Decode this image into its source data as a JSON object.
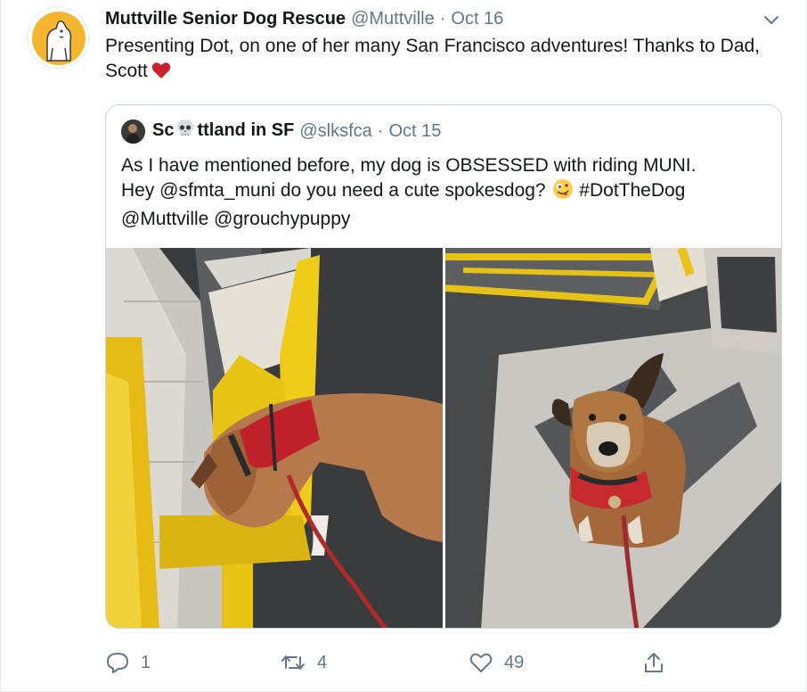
{
  "tweet": {
    "author_name": "Muttville Senior Dog Rescue",
    "handle": "@Muttville",
    "separator": "·",
    "date": "Oct 16",
    "text": "Presenting Dot, on one of her many San Francisco adventures! Thanks to Dad, Scott",
    "heart_emoji": "red-heart",
    "avatar_icon": "dog-logo-icon",
    "menu_icon": "chevron-down-icon"
  },
  "quoted_tweet": {
    "name_start": "Sc",
    "name_emoji": "skull",
    "name_end": "ttland in SF",
    "handle": "@slksfca",
    "separator": "·",
    "date": "Oct 15",
    "text_line1": "As I have mentioned before, my dog is OBSESSED with riding MUNI.",
    "text_line2": "Hey @sfmta_muni do you need a cute spokesdog?",
    "hashtag": "#DotTheDog",
    "text_line3": "@Muttville @grouchypuppy",
    "photos": [
      "dog-on-muni-looking-down",
      "dog-on-muni-looking-up"
    ]
  },
  "actions": {
    "reply_count": "1",
    "retweet_count": "4",
    "like_count": "49"
  },
  "colors": {
    "text": "#14171a",
    "secondary": "#657786",
    "border": "#ccd6dd",
    "heart": "#e0245e",
    "logo_yellow": "#f5b52e"
  }
}
